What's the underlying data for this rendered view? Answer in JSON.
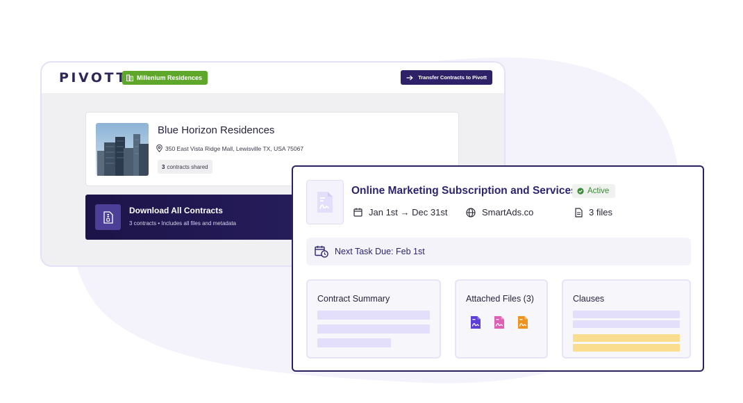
{
  "app": {
    "logo_text": "PIVOTT",
    "property_tag": "Millenium Residences",
    "transfer_button": "Transfer Contracts to Pivott"
  },
  "property": {
    "name": "Blue Horizon Residences",
    "address": "350 East Vista Ridge Mall, Lewisville TX, USA 75067",
    "contracts_count": "3",
    "contracts_suffix": "contracts shared"
  },
  "download": {
    "title": "Download All Contracts",
    "subtitle": "3 contracts  •  Includes all files and metadata"
  },
  "contract": {
    "title": "Online Marketing Subscription and Services",
    "status": "Active",
    "period": "Jan 1st → Dec 31st",
    "vendor": "SmartAds.co",
    "files": "3 files",
    "next_task": "Next Task Due: Feb 1st"
  },
  "panels": {
    "summary_title": "Contract Summary",
    "attached_title": "Attached Files (3)",
    "clauses_title": "Clauses"
  },
  "colors": {
    "brand_dark": "#2d2470",
    "tag_green": "#5ea72a",
    "status_green": "#3b8a36",
    "file_purple": "#5b3fd6",
    "file_pink": "#df5fb5",
    "file_orange": "#f0931e"
  },
  "icons": {
    "calendar": "calendar-icon",
    "globe": "globe-icon",
    "document": "document-icon",
    "location": "location-pin-icon",
    "calendar_clock": "calendar-clock-icon",
    "arrow": "arrow-right-icon"
  }
}
